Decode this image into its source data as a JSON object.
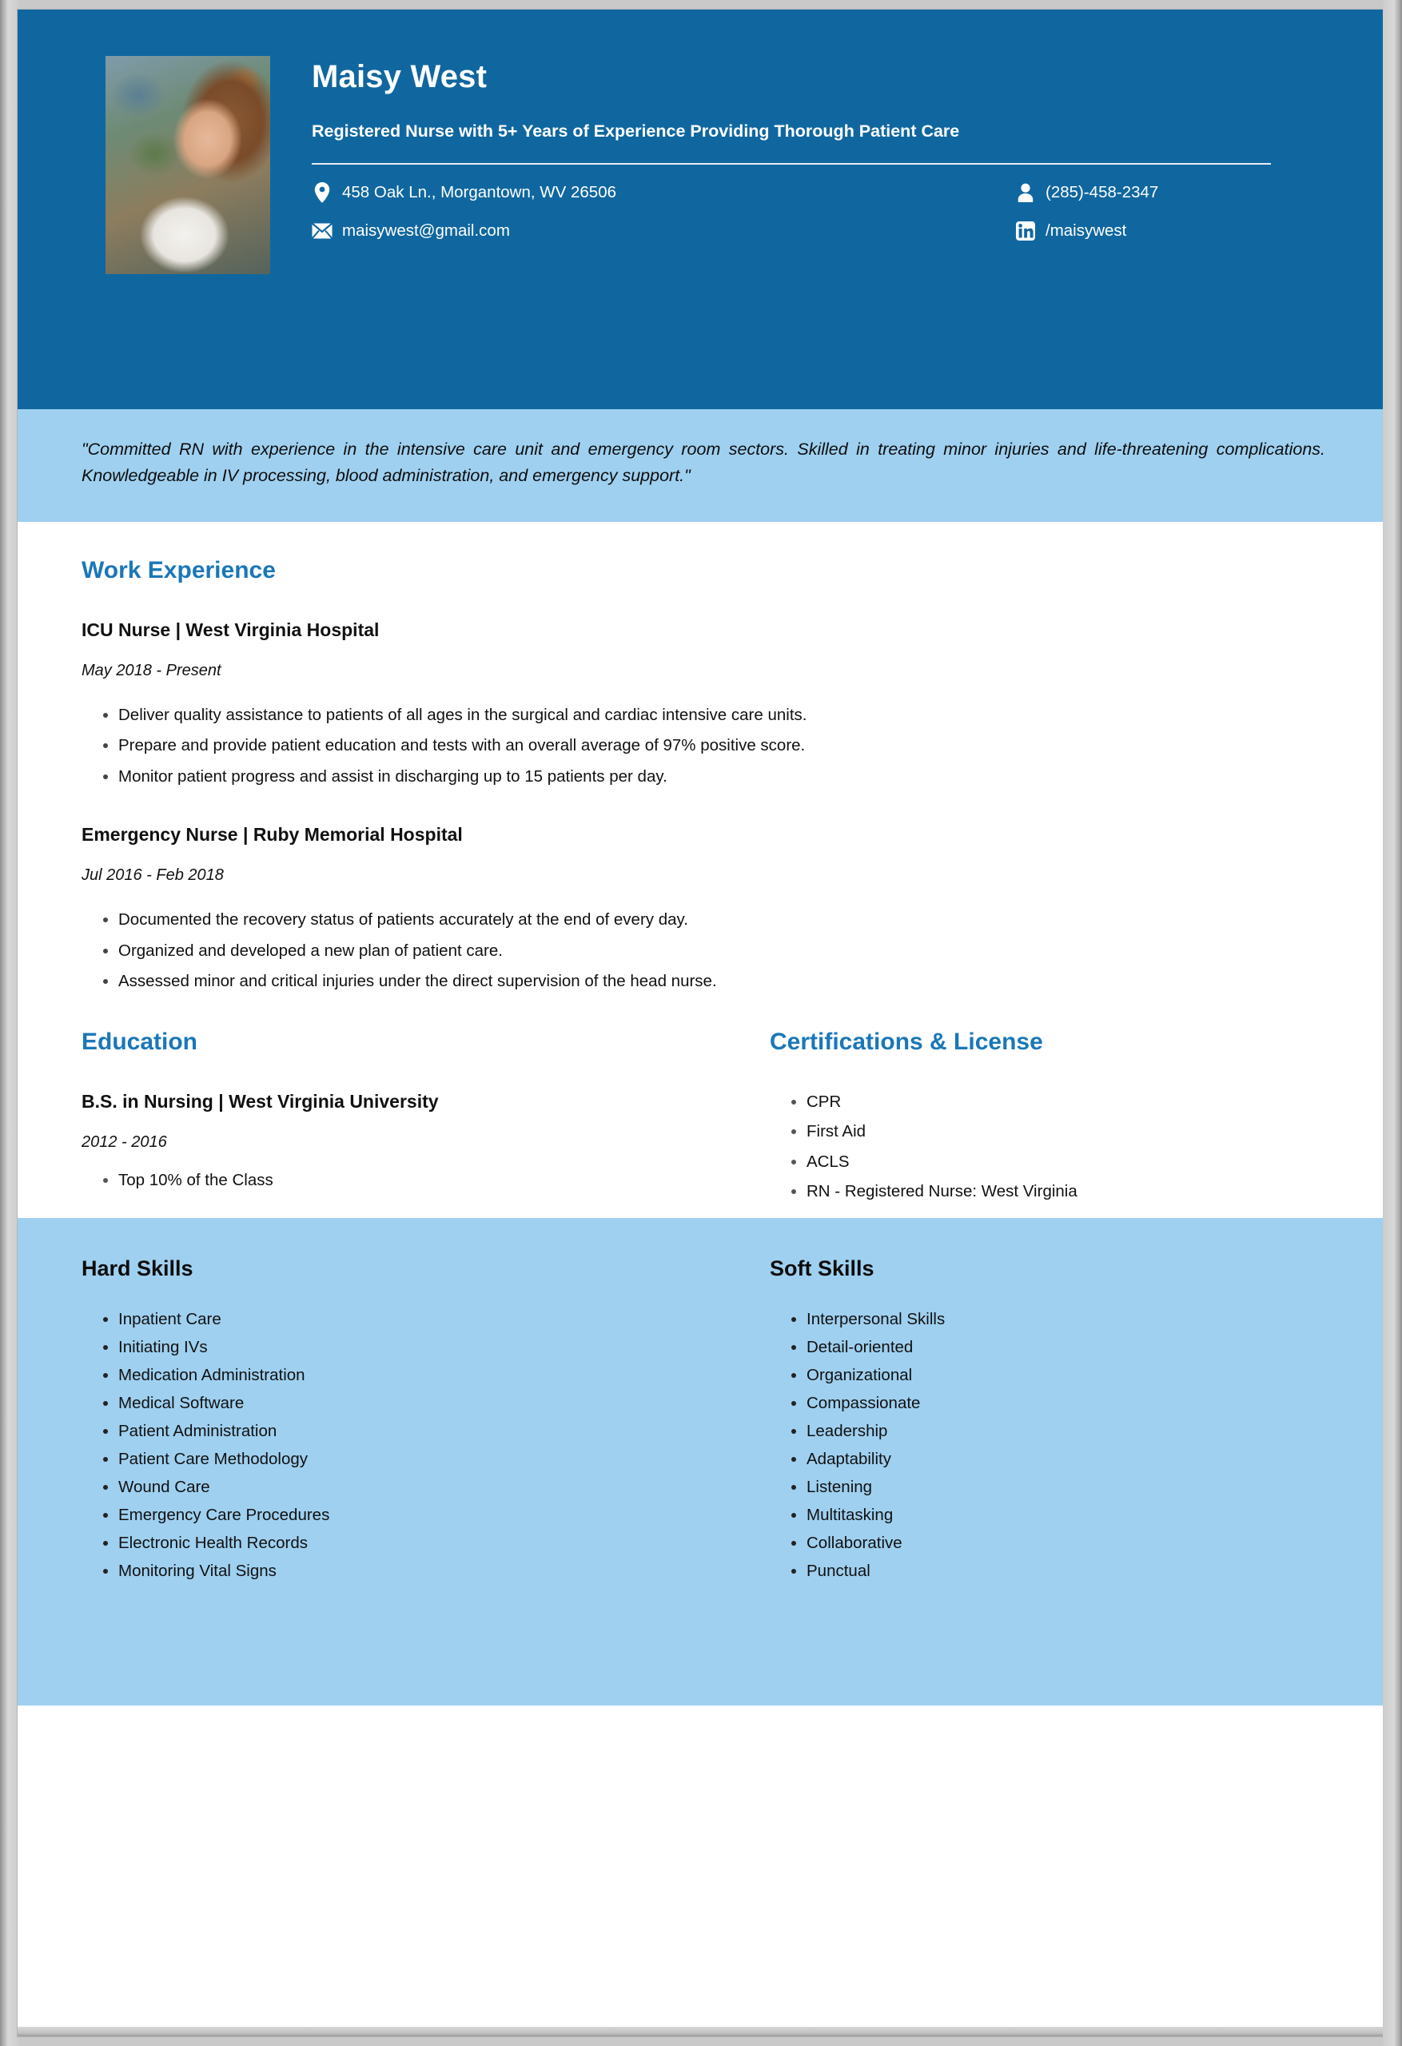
{
  "colors": {
    "header_blue": "#10679f",
    "band_blue": "#9fd0f0",
    "section_title_blue": "#1a77b8",
    "paper_white": "#ffffff",
    "page_gray": "#cccccc"
  },
  "header": {
    "name": "Maisy West",
    "headline": "Registered Nurse with 5+ Years of Experience Providing Thorough Patient Care",
    "photo_alt": "profile-photo",
    "contacts": [
      {
        "icon": "location-pin-icon",
        "text": "458 Oak Ln., Morgantown, WV 26506"
      },
      {
        "icon": "person-icon",
        "text": "(285)-458-2347"
      },
      {
        "icon": "envelope-icon",
        "text": "maisywest@gmail.com"
      },
      {
        "icon": "linkedin-icon",
        "text": "/maisywest"
      }
    ]
  },
  "summary": {
    "text": "\"Committed RN with experience in the intensive care unit and emergency room sectors. Skilled in treating minor injuries and life-threatening complications. Knowledgeable in IV processing, blood administration, and emergency support.\""
  },
  "work_experience": {
    "title": "Work Experience",
    "jobs": [
      {
        "role": "ICU Nurse",
        "separator": " | ",
        "company": "West Virginia Hospital",
        "dates": "May 2018 - Present",
        "bullets": [
          "Deliver quality assistance to patients of all ages in the surgical and cardiac intensive care units.",
          "Prepare and provide patient education and tests with an overall average of 97% positive score.",
          "Monitor patient progress and assist in discharging up to 15 patients per day."
        ]
      },
      {
        "role": "Emergency Nurse",
        "separator": " | ",
        "company": "Ruby Memorial Hospital",
        "dates": "Jul 2016 - Feb 2018",
        "bullets": [
          "Documented the recovery status of patients accurately at the end of every day.",
          "Organized and developed a new plan of patient care.",
          "Assessed minor and critical injuries under the direct supervision of the head nurse."
        ]
      }
    ]
  },
  "education": {
    "title": "Education",
    "degree": "B.S. in Nursing",
    "separator": " | ",
    "school": "West Virginia University",
    "dates": "2012 - 2016",
    "highlights": [
      "Top 10% of the Class"
    ]
  },
  "certifications": {
    "title": "Certifications & License",
    "items": [
      "CPR",
      "First Aid",
      "ACLS",
      "RN - Registered Nurse: West Virginia"
    ]
  },
  "hard_skills": {
    "title": "Hard Skills",
    "items": [
      "Inpatient Care",
      "Initiating IVs",
      "Medication Administration",
      "Medical Software",
      "Patient Administration",
      "Patient Care Methodology",
      "Wound Care",
      "Emergency Care Procedures",
      "Electronic Health Records",
      "Monitoring Vital Signs"
    ]
  },
  "soft_skills": {
    "title": "Soft Skills",
    "items": [
      "Interpersonal Skills",
      "Detail-oriented",
      "Organizational",
      "Compassionate",
      "Leadership",
      "Adaptability",
      "Listening",
      "Multitasking",
      "Collaborative",
      "Punctual"
    ]
  }
}
